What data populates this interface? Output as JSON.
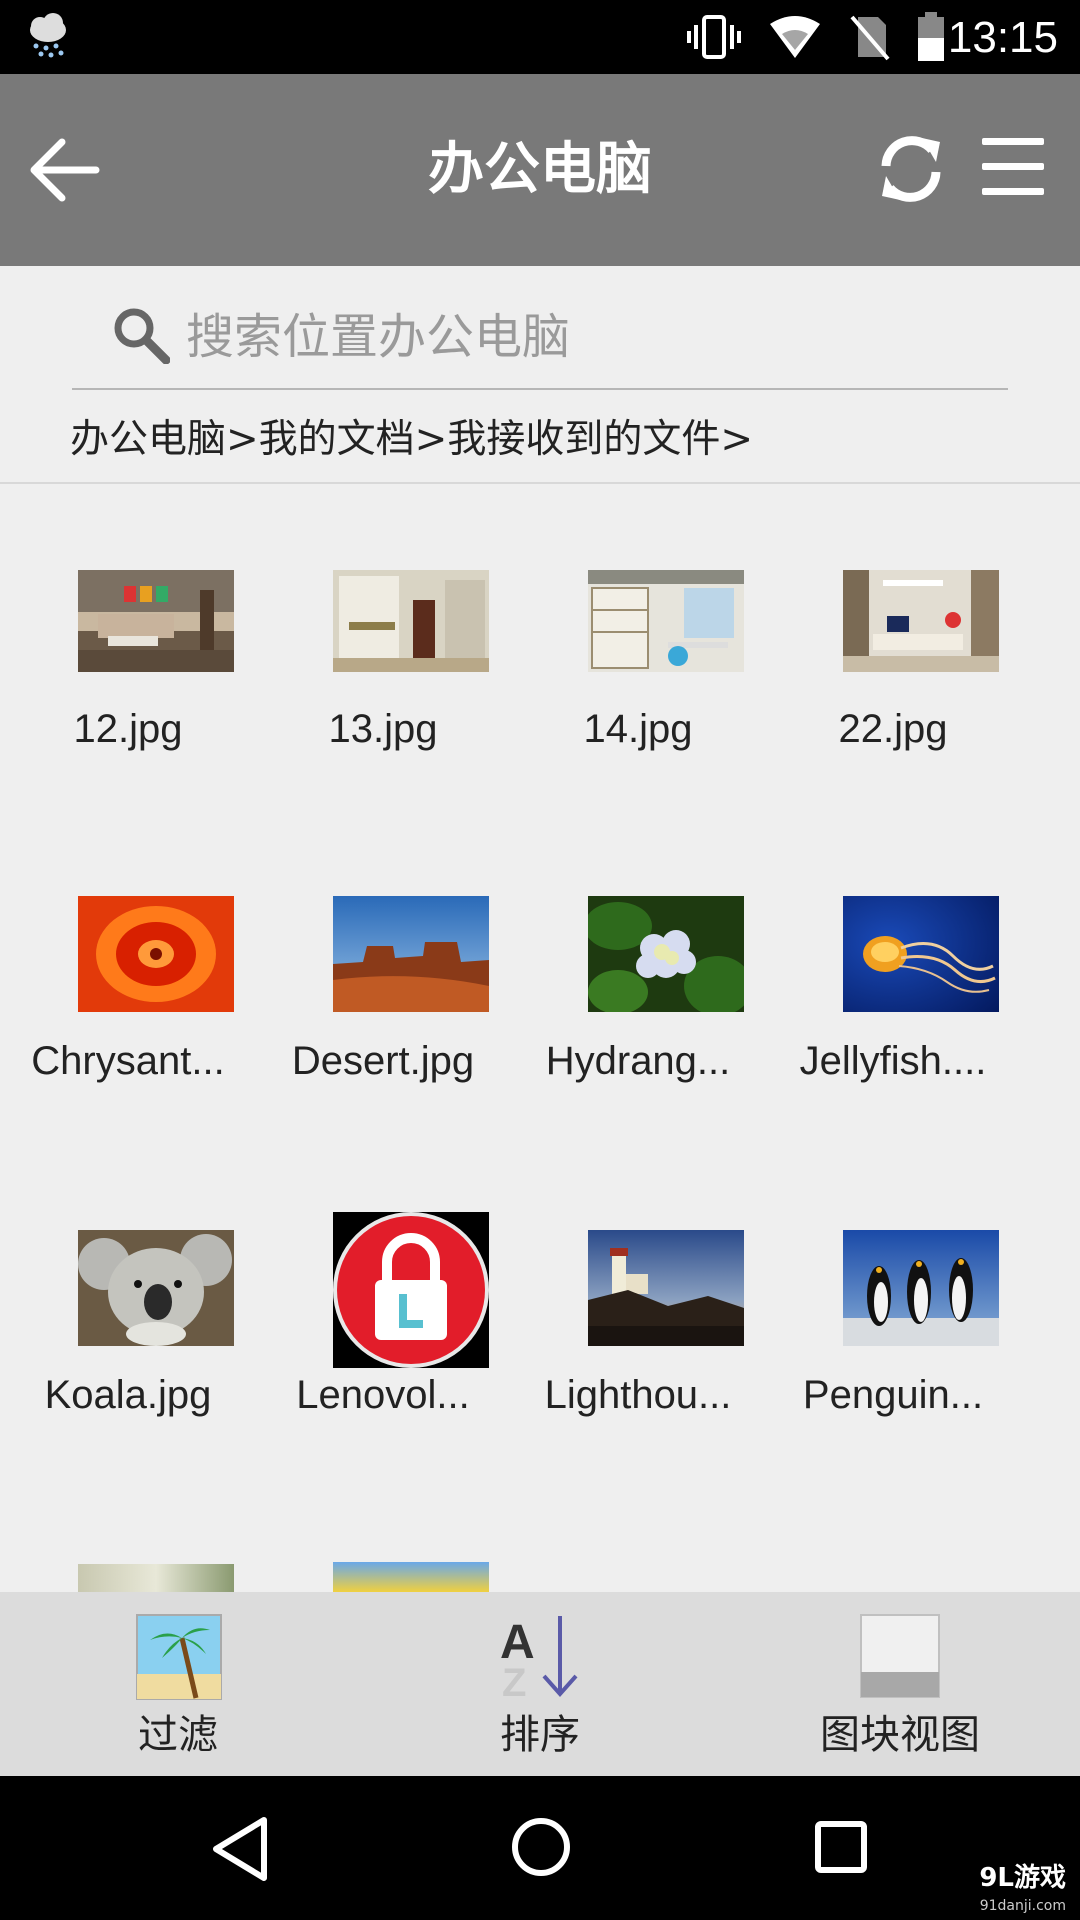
{
  "status_bar": {
    "time": "13:15",
    "icons": [
      "cloud-rain-icon",
      "vibrate-icon",
      "wifi-icon",
      "no-sim-icon",
      "battery-icon"
    ]
  },
  "app_bar": {
    "title": "办公电脑",
    "back_icon": "back-arrow-icon",
    "refresh_icon": "refresh-icon",
    "menu_icon": "menu-icon"
  },
  "search": {
    "placeholder": "搜索位置办公电脑",
    "value": ""
  },
  "breadcrumb": "办公电脑>我的文档>我接收到的文件>",
  "files": [
    {
      "name": "12.jpg"
    },
    {
      "name": "13.jpg"
    },
    {
      "name": "14.jpg"
    },
    {
      "name": "22.jpg"
    },
    {
      "name": "Chrysant..."
    },
    {
      "name": "Desert.jpg"
    },
    {
      "name": "Hydrang..."
    },
    {
      "name": "Jellyfish...."
    },
    {
      "name": "Koala.jpg"
    },
    {
      "name": "Lenovol..."
    },
    {
      "name": "Lighthou..."
    },
    {
      "name": "Penguin..."
    }
  ],
  "toolbar": {
    "filter_label": "过滤",
    "sort_label": "排序",
    "view_label": "图块视图",
    "sort_icon_text": "A"
  },
  "watermark": {
    "brand": "9L游戏",
    "site": "91danji.com"
  },
  "colors": {
    "app_bar": "#797979",
    "background": "#efefef",
    "toolbar": "#dcdcdc"
  }
}
